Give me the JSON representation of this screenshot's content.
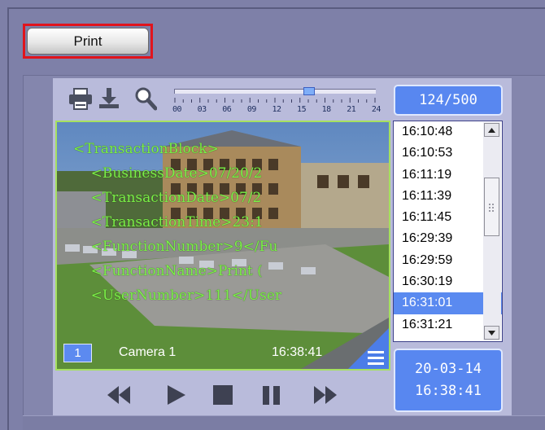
{
  "print_button": {
    "label": "Print"
  },
  "toolbar": {
    "icons": [
      "printer-icon",
      "download-icon",
      "search-icon"
    ],
    "timeline_ticks": [
      "00",
      "03",
      "06",
      "09",
      "12",
      "15",
      "18",
      "21",
      "24"
    ],
    "timeline_position": 0.67
  },
  "counter": {
    "text": "124/500"
  },
  "video": {
    "overlay_lines": [
      "<TransactionBlock>",
      "    <BusinessDate>07/20/2",
      "    <TransactionDate>07/2",
      "    <TransactionTime>23:1",
      "    <FunctionNumber>9</Fu",
      "    <FunctionName>Print (",
      "    <UserNumber>111</User"
    ],
    "camera_number": "1",
    "camera_name": "Camera 1",
    "time": "16:38:41"
  },
  "time_list": {
    "items": [
      "16:10:48",
      "16:10:53",
      "16:11:19",
      "16:11:39",
      "16:11:45",
      "16:29:39",
      "16:29:59",
      "16:30:19",
      "16:31:01",
      "16:31:21"
    ],
    "selected_index": 8
  },
  "datetime": {
    "date": "20-03-14",
    "time": "16:38:41"
  },
  "playback": {
    "controls": [
      "rewind-icon",
      "play-icon",
      "stop-icon",
      "pause-icon",
      "fast-forward-icon"
    ]
  },
  "colors": {
    "accent": "#5887f0",
    "overlay_text": "#7cf04a",
    "highlight": "#e0141c"
  }
}
